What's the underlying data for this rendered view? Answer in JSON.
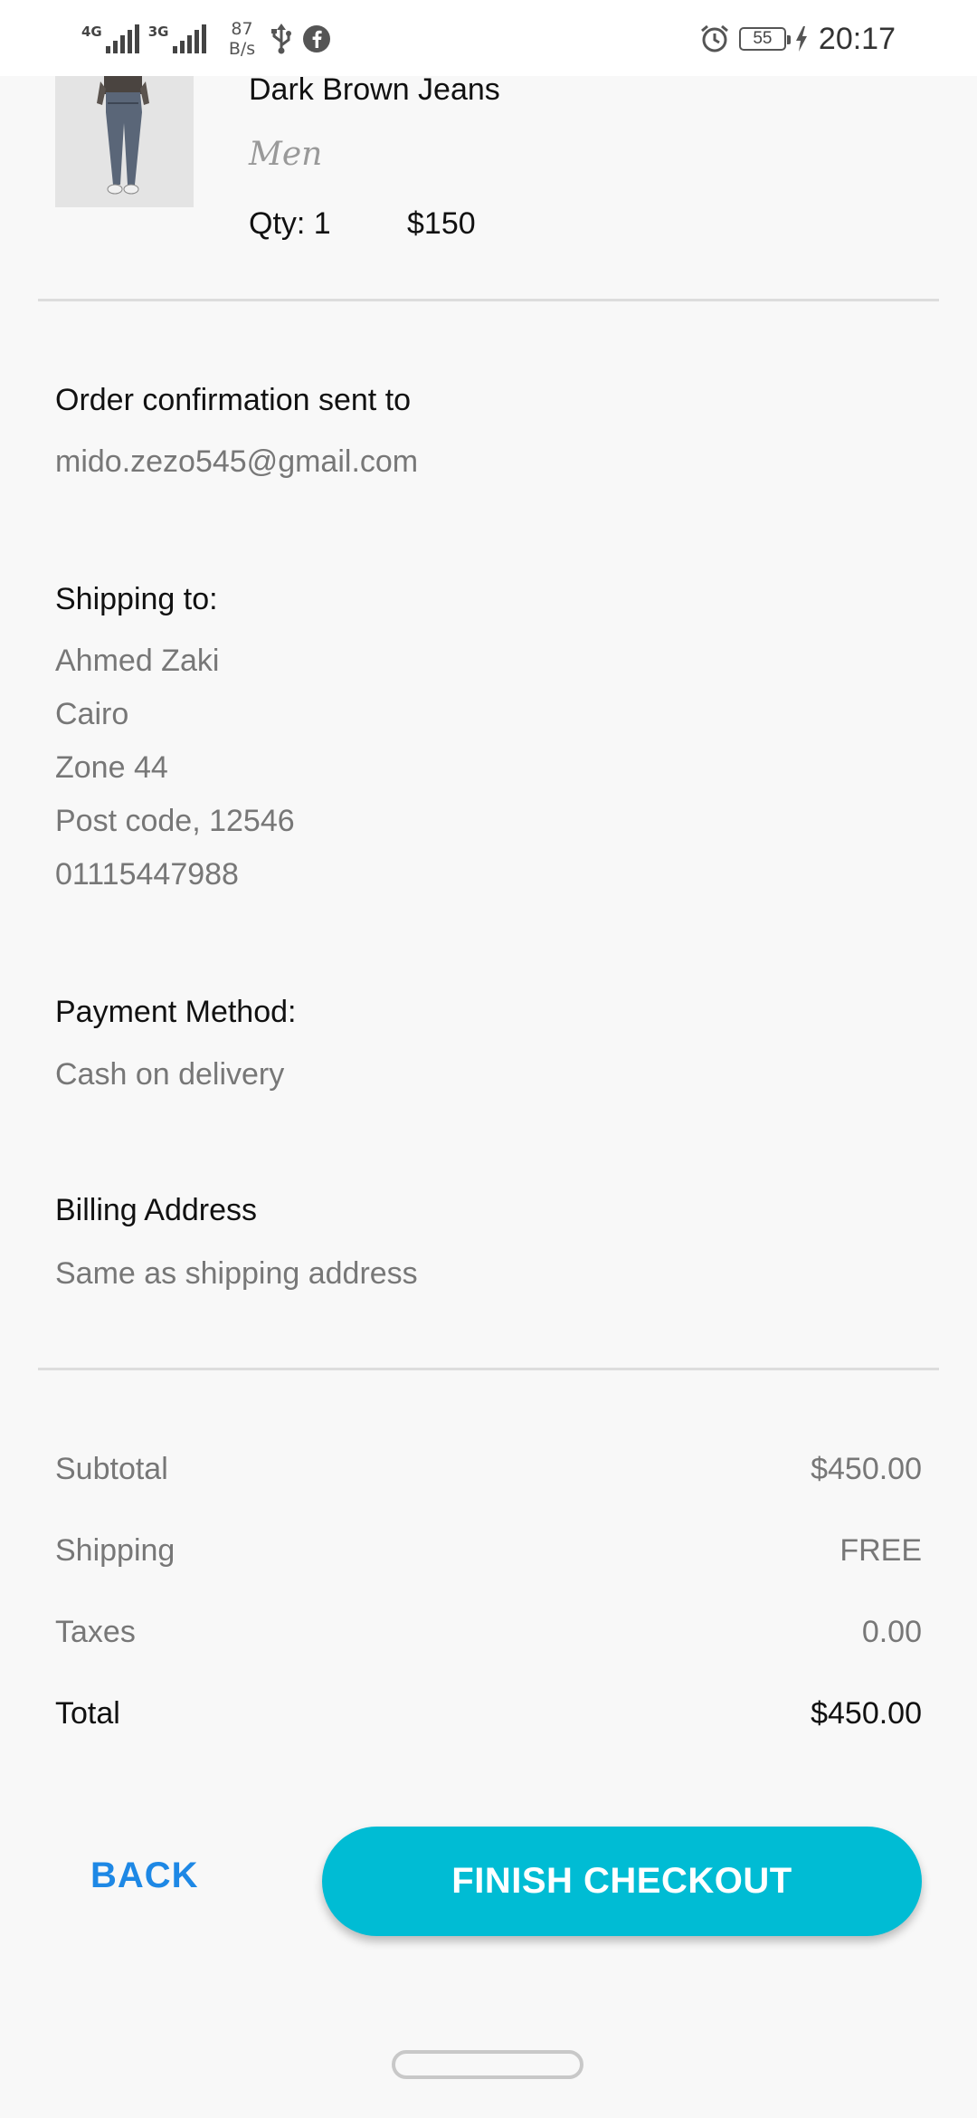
{
  "status_bar": {
    "network_1": "4G",
    "network_2": "3G",
    "speed_value": "87",
    "speed_unit": "B/s",
    "battery_level": "55",
    "time": "20:17",
    "icons": [
      "signal-icon",
      "usb-icon",
      "facebook-icon",
      "alarm-icon",
      "battery-icon",
      "charging-icon"
    ]
  },
  "product": {
    "image_icon": "jeans-product-image",
    "name": "Dark Brown Jeans",
    "category": "Men",
    "qty": "Qty: 1",
    "price": "$150"
  },
  "confirmation": {
    "label": "Order confirmation sent to",
    "email": "mido.zezo545@gmail.com"
  },
  "shipping": {
    "label": "Shipping to:",
    "lines": [
      "Ahmed Zaki",
      "Cairo",
      "Zone 44",
      "Post code, 12546",
      "01115447988"
    ]
  },
  "payment": {
    "label": "Payment Method:",
    "value": "Cash on delivery"
  },
  "billing": {
    "label": "Billing Address",
    "value": "Same as shipping address"
  },
  "totals": {
    "subtotal_label": "Subtotal",
    "subtotal_value": "$450.00",
    "shipping_label": "Shipping",
    "shipping_value": "FREE",
    "taxes_label": "Taxes",
    "taxes_value": "0.00",
    "total_label": "Total",
    "total_value": "$450.00"
  },
  "actions": {
    "back_label": "BACK",
    "finish_label": "FINISH CHECKOUT"
  },
  "colors": {
    "accent_button": "#00bcd4",
    "back_text": "#1e88e5",
    "background": "#f8f8f8"
  }
}
